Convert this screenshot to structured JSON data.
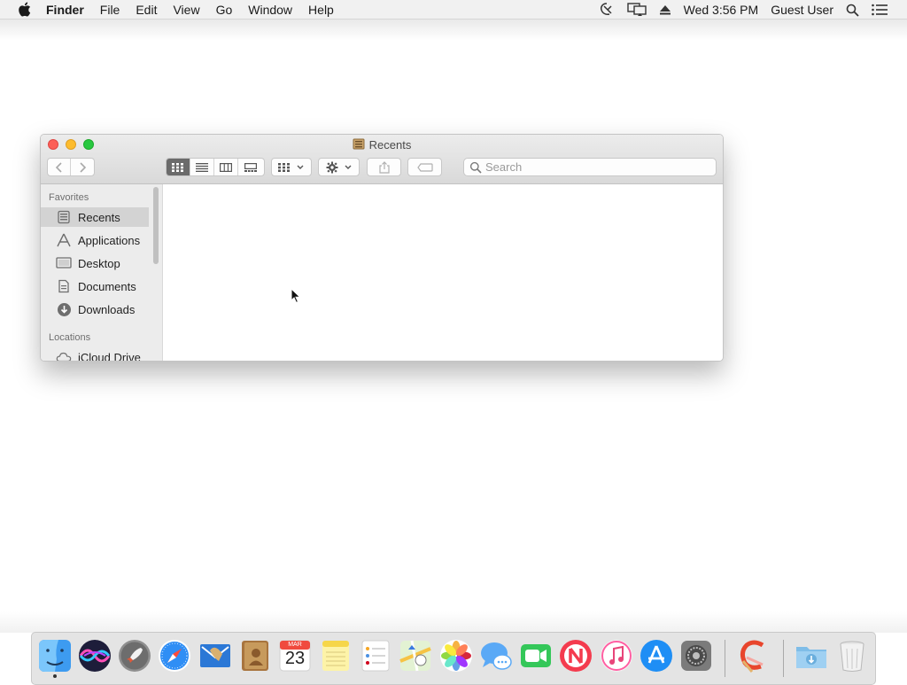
{
  "menubar": {
    "app_name": "Finder",
    "items": [
      "File",
      "Edit",
      "View",
      "Go",
      "Window",
      "Help"
    ],
    "clock": "Wed 3:56 PM",
    "user": "Guest User"
  },
  "window": {
    "title": "Recents",
    "search_placeholder": "Search",
    "sidebar": {
      "favorites_header": "Favorites",
      "favorites": [
        {
          "label": "Recents",
          "icon": "recents-icon",
          "selected": true
        },
        {
          "label": "Applications",
          "icon": "applications-icon"
        },
        {
          "label": "Desktop",
          "icon": "desktop-icon"
        },
        {
          "label": "Documents",
          "icon": "documents-icon"
        },
        {
          "label": "Downloads",
          "icon": "downloads-icon"
        }
      ],
      "locations_header": "Locations",
      "locations": [
        {
          "label": "iCloud Drive",
          "icon": "icloud-icon"
        }
      ]
    }
  },
  "dock": {
    "calendar_month": "MAR",
    "calendar_day": "23",
    "apps": [
      "Finder",
      "Siri",
      "Launchpad",
      "Safari",
      "Mail",
      "Contacts",
      "Calendar",
      "Notes",
      "Reminders",
      "Maps",
      "Photos",
      "Messages",
      "FaceTime",
      "News",
      "iTunes",
      "App Store",
      "System Preferences",
      "CCleaner",
      "Downloads",
      "Trash"
    ]
  }
}
